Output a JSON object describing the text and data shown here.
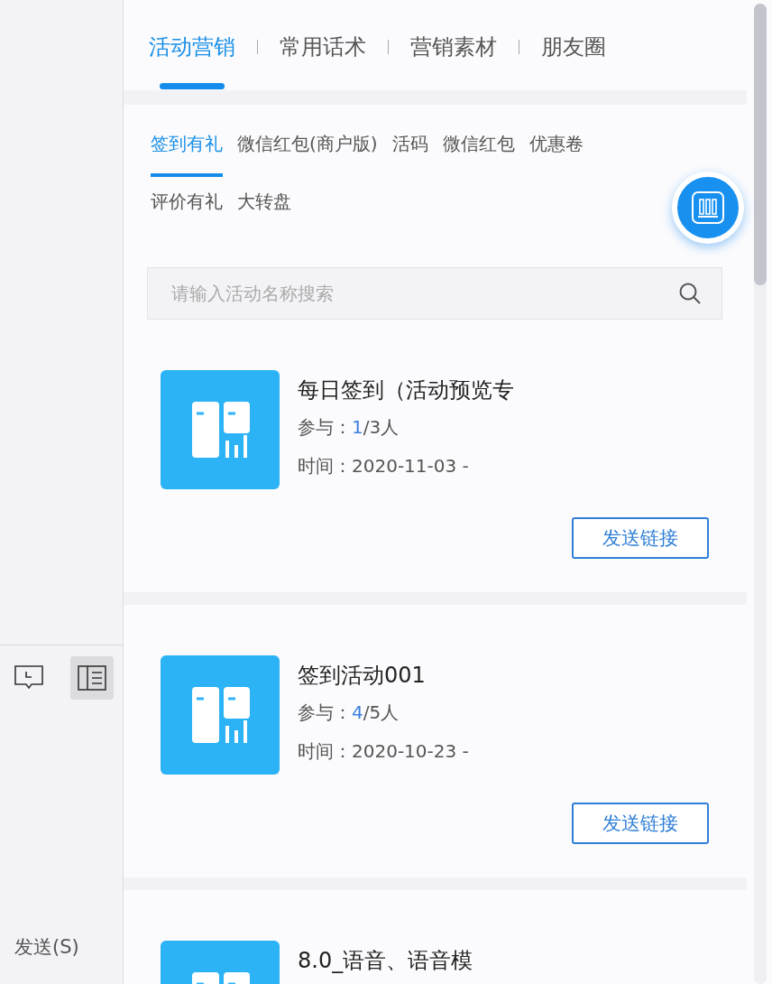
{
  "sidebar": {
    "tools": [
      {
        "kind": "comment-clock",
        "selected": false
      },
      {
        "kind": "panel",
        "selected": true
      }
    ],
    "send_button": "发送(S)"
  },
  "tabs": [
    {
      "label": "活动营销",
      "selected": true
    },
    {
      "label": "常用话术",
      "selected": false
    },
    {
      "label": "营销素材",
      "selected": false
    },
    {
      "label": "朋友圈",
      "selected": false
    }
  ],
  "subtabs": [
    {
      "label": "签到有礼",
      "selected": true
    },
    {
      "label": "微信红包(商户版)",
      "selected": false
    },
    {
      "label": "活码",
      "selected": false
    },
    {
      "label": "微信红包",
      "selected": false
    },
    {
      "label": "优惠卷",
      "selected": false
    },
    {
      "label": "评价有礼",
      "selected": false
    },
    {
      "label": "大转盘",
      "selected": false
    }
  ],
  "search": {
    "placeholder": "请输入活动名称搜索"
  },
  "activities": [
    {
      "title": "每日签到（活动预览专",
      "participation_label": "参与：",
      "joined": "1",
      "total": "/3人",
      "time_label": "时间：",
      "time": "2020-11-03 -",
      "button": "发送链接"
    },
    {
      "title": "签到活动001",
      "participation_label": "参与：",
      "joined": "4",
      "total": "/5人",
      "time_label": "时间：",
      "time": "2020-10-23 -",
      "button": "发送链接"
    },
    {
      "title": "8.0_语音、语音模"
    }
  ]
}
